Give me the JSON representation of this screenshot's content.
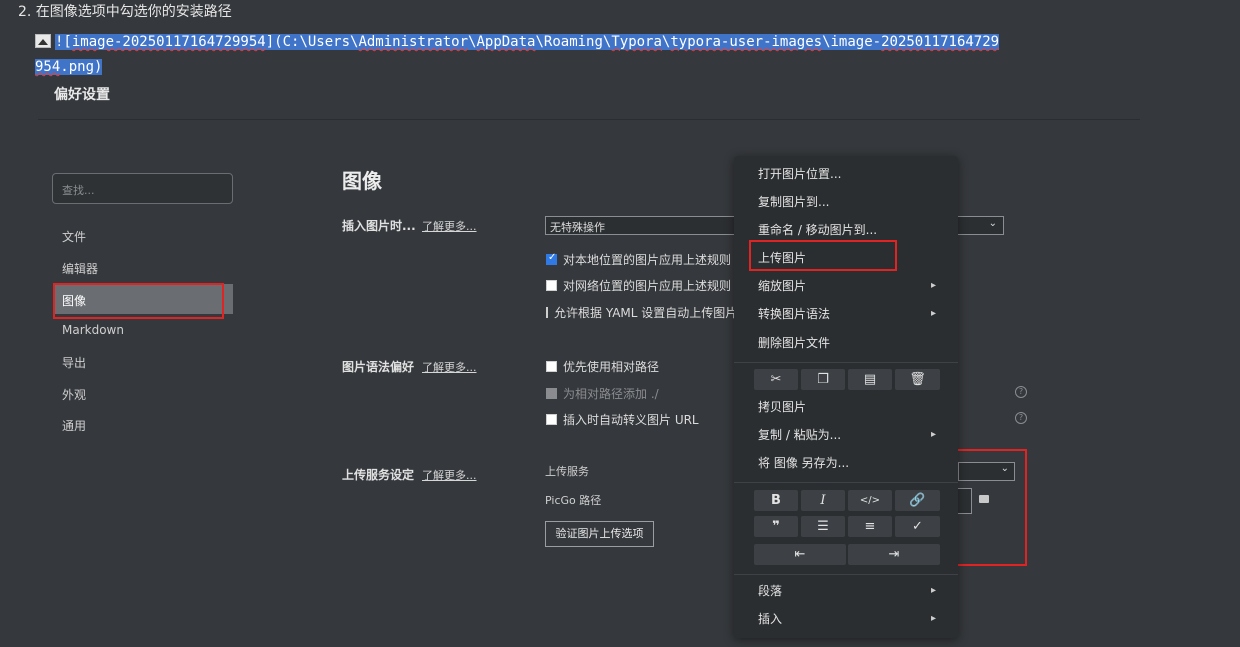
{
  "note": {
    "step": "2. 在图像选项中勾选你的安装路径",
    "markdown_line1_pre": "![",
    "markdown_sq1": "image-20250117164729954",
    "markdown_mid1": "](C:\\Users\\",
    "markdown_sq2": "Administrator",
    "markdown_mid2": "\\",
    "markdown_sq3": "AppData",
    "markdown_mid3": "\\Roaming\\",
    "markdown_sq4": "Typora",
    "markdown_mid4": "\\",
    "markdown_sq5": "typora-user-images",
    "markdown_mid5": "\\image-",
    "markdown_sq6": "20250117164729",
    "markdown_line2_sq": "954",
    "markdown_line2_rest": ".png)"
  },
  "prefs": {
    "title": "偏好设置",
    "search_placeholder": "查找...",
    "nav": [
      "文件",
      "编辑器",
      "图像",
      "Markdown",
      "导出",
      "外观",
      "通用"
    ],
    "section_title": "图像",
    "insert_label": "插入图片时...",
    "learn_more": "了解更多...",
    "insert_select": "无特殊操作",
    "insert_checks": [
      {
        "label": "对本地位置的图片应用上述规则",
        "checked": true
      },
      {
        "label": "对网络位置的图片应用上述规则",
        "checked": false
      },
      {
        "label": "允许根据 YAML 设置自动上传图片",
        "checked": false
      }
    ],
    "syntax_label": "图片语法偏好",
    "syntax_checks": [
      {
        "label": "优先使用相对路径",
        "checked": false
      },
      {
        "label": "为相对路径添加 ./",
        "checked": false,
        "disabled": true
      },
      {
        "label": "插入时自动转义图片 URL",
        "checked": false
      }
    ],
    "upload_label": "上传服务设定",
    "upload_service_label": "上传服务",
    "picgo_path_label": "PicGo 路径",
    "verify_button": "验证图片上传选项",
    "help_glyph": "?"
  },
  "context_menu": {
    "items_top": [
      "打开图片位置...",
      "复制图片到...",
      "重命名 / 移动图片到...",
      "上传图片",
      "缩放图片",
      "转换图片语法",
      "删除图片文件"
    ],
    "items_mid": [
      "拷贝图片",
      "复制 / 粘贴为...",
      "将 图像 另存为..."
    ],
    "items_bottom": [
      "段落",
      "插入"
    ],
    "toolbar1": [
      "scissors-icon",
      "copy-icon",
      "paste-icon",
      "trash-icon"
    ],
    "format_row1": [
      "B",
      "I",
      "</>",
      "link"
    ],
    "format_row2": [
      "quote",
      "ordered-list",
      "unordered-list",
      "task-list"
    ],
    "format_row3": [
      "outdent",
      "indent"
    ],
    "submenu_arrow": "▸"
  },
  "colors": {
    "selection": "#3f74c9",
    "highlight_box": "#e02424",
    "active_nav": "#6a6d72",
    "menu_bg": "#2b2e31"
  }
}
